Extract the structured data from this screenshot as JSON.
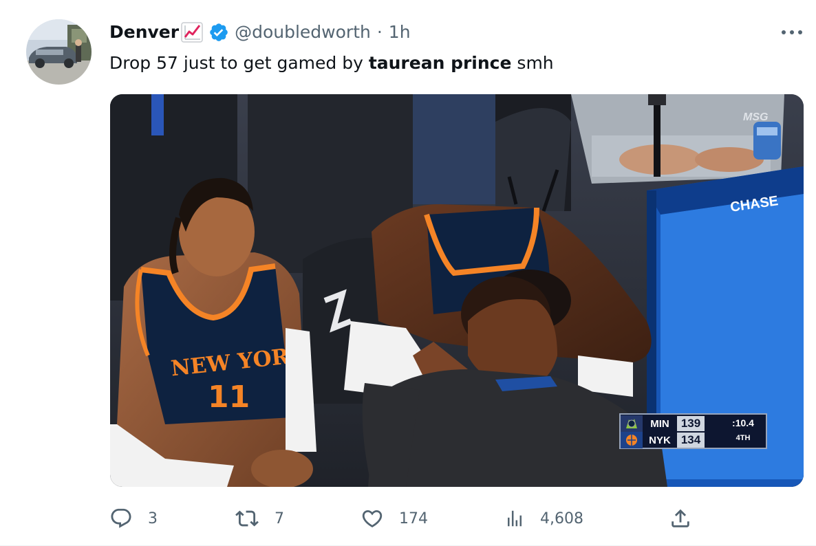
{
  "author": {
    "display_name": "Denver",
    "handle": "@doubledworth",
    "separator": "·",
    "time": "1h",
    "emoji_icon": "chart-increasing-icon",
    "verified_icon": "verified-badge-icon",
    "verified_color": "#1d9bf0"
  },
  "tweet": {
    "text_before": "Drop 57 just to get gamed by ",
    "text_bold": "taurean prince",
    "text_after": " smh"
  },
  "media": {
    "jersey_text": "NEW YORK",
    "jersey_number": "11",
    "sponsor_text": "CHASE",
    "network_text": "MSG",
    "scoreboard": {
      "away_team": "MIN",
      "away_score": "139",
      "home_team": "NYK",
      "home_score": "134",
      "clock": ":10.4",
      "period": "4TH"
    }
  },
  "actions": {
    "replies": "3",
    "retweets": "7",
    "likes": "174",
    "views": "4,608"
  },
  "colors": {
    "text_primary": "#0f1419",
    "text_secondary": "#536471",
    "accent": "#1d9bf0",
    "knicks_orange": "#f58426",
    "knicks_blue": "#0e2240"
  }
}
